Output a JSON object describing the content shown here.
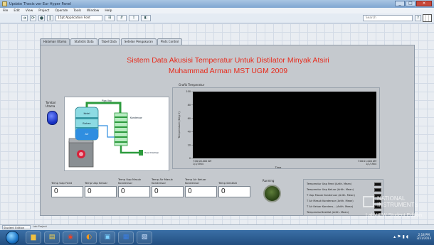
{
  "window": {
    "title": "Update Thesis ver Eur Hyper Panel",
    "controls": [
      "_",
      "□",
      "×"
    ]
  },
  "menu": [
    "File",
    "Edit",
    "View",
    "Project",
    "Operate",
    "Tools",
    "Window",
    "Help"
  ],
  "toolbar": {
    "font": "15pt Application Font",
    "search_placeholder": "Search"
  },
  "tabs": [
    "Halaman Utama",
    "Statistik Data",
    "Tabel Data",
    "Setelan Pengukuran",
    "Plots Control"
  ],
  "heading": {
    "line1": "Sistem Data Akusisi Temperatur Untuk Distilator Minyak Atsiri",
    "line2": "Muhammad Arman MST UGM 2009"
  },
  "stop_button": {
    "label": "Tombol Utama"
  },
  "diagram_labels": {
    "condenser": "Kondensor",
    "tank_top": "Ketel",
    "tank_mid": "Bahan",
    "tank_water": "Air",
    "pipe": "Pipa Uap",
    "outlet": "Hasil Distilasi"
  },
  "chart_data": {
    "type": "line",
    "title": "Grafik Temperatur",
    "xlabel": "Time",
    "ylabel": "Temperature (Deg C)",
    "ylim": [
      0,
      100
    ],
    "y_ticks": [
      "100",
      "80",
      "60",
      "40",
      "20",
      "0"
    ],
    "x_ticks": [
      {
        "time": "7:00:00.000 AM",
        "date": "1/1/1904"
      },
      {
        "time": "7:00:01.000 AM",
        "date": "1/1/1904"
      }
    ],
    "series": []
  },
  "indicators": [
    {
      "label": "Temp Uap Feed",
      "value": "0"
    },
    {
      "label": "Temp Uap Keluar",
      "value": "0"
    },
    {
      "label": "Temp Uap Masuk Kondensor",
      "value": "0"
    },
    {
      "label": "Temp Air Masuk Kondensor",
      "value": "0"
    },
    {
      "label": "Temp Air Keluar Kondensor",
      "value": "0"
    },
    {
      "label": "Temp Destilat",
      "value": "0"
    }
  ],
  "running": {
    "label": "Running"
  },
  "legend": [
    "Temperatur Uap Feed (Arith. Mean)",
    "Temperatur Uap Keluar (Arith. Mean)",
    "T Uap Masuk Kondensor (Arith. Mean)",
    "T Air Masuk Kondensor (Arith. Mean)",
    "T Air Keluar Kondens... (Arith. Mean)",
    "TemperaturDestilat (Arith. Mean)"
  ],
  "watermark": {
    "line1": "NATIONAL",
    "line2": "INSTRUMENTS",
    "line3": "LabVIEW Student Edition"
  },
  "statusbar": {
    "edition": "Student Edition",
    "project": "Lab Project"
  },
  "taskbar": {
    "time": "2:18 PM",
    "date": "3/21/2013"
  }
}
